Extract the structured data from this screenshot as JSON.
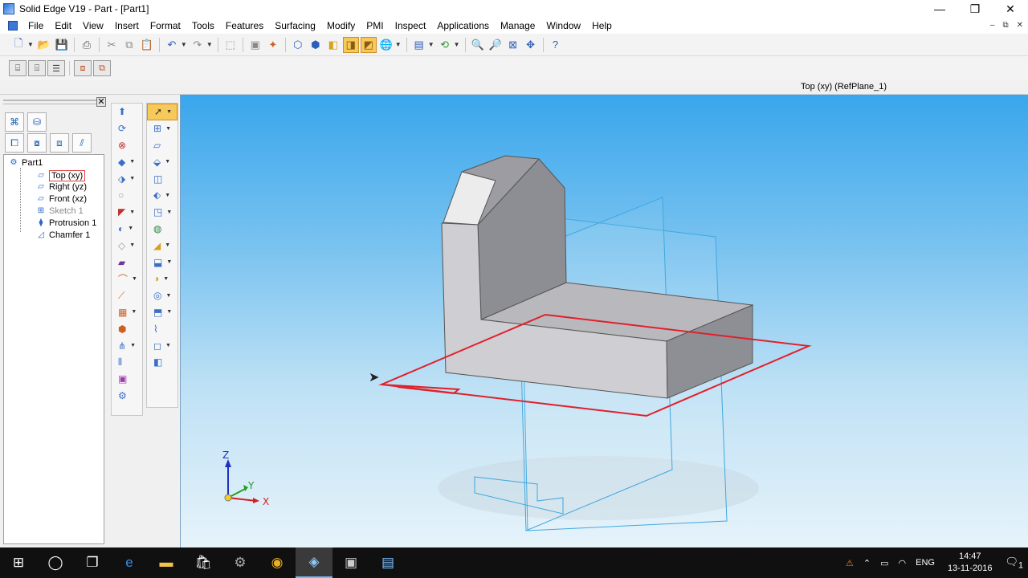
{
  "window": {
    "title": "Solid Edge V19 - Part - [Part1]"
  },
  "window_controls": {
    "minimize": "—",
    "restore": "❐",
    "close": "✕"
  },
  "mdi_controls": {
    "minimize": "–",
    "restore": "⧉",
    "close": "✕"
  },
  "menu": [
    "File",
    "Edit",
    "View",
    "Insert",
    "Format",
    "Tools",
    "Features",
    "Surfacing",
    "Modify",
    "PMI",
    "Inspect",
    "Applications",
    "Manage",
    "Window",
    "Help"
  ],
  "status": {
    "active_plane": "Top (xy) (RefPlane_1)"
  },
  "tree": {
    "root": "Part1",
    "items": [
      {
        "label": "Top (xy)",
        "icon": "plane-icon"
      },
      {
        "label": "Right (yz)",
        "icon": "plane-icon"
      },
      {
        "label": "Front (xz)",
        "icon": "plane-icon"
      },
      {
        "label": "Sketch 1",
        "icon": "sketch-icon"
      },
      {
        "label": "Protrusion 1",
        "icon": "protrusion-icon"
      },
      {
        "label": "Chamfer 1",
        "icon": "chamfer-icon"
      }
    ]
  },
  "triad": {
    "z": "Z",
    "y": "Y",
    "x": "X"
  },
  "colors": {
    "viewport_top": "#39a6ec",
    "viewport_bottom": "#e6f3fa",
    "sketch_red": "#e0202a",
    "plane_blue": "#3fa8e0",
    "highlight": "#f7c95a"
  },
  "taskbar": {
    "apps": [
      "start-icon",
      "cortana-icon",
      "task-view-icon",
      "edge-icon",
      "file-explorer-icon",
      "store-icon",
      "app-icon",
      "chrome-icon",
      "solid-edge-icon",
      "app2-icon",
      "app3-icon"
    ],
    "language": "ENG",
    "time": "14:47",
    "date": "13-11-2016",
    "notifications": "1"
  }
}
